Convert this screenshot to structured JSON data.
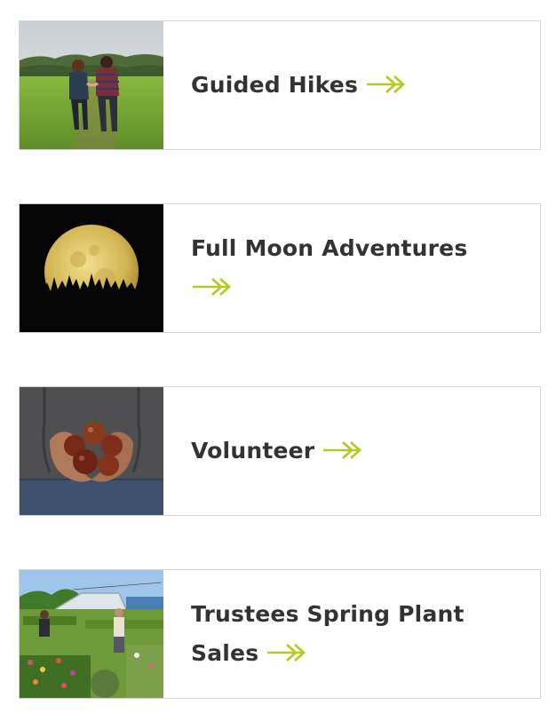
{
  "accent_color": "#b6c81e",
  "title_color": "#333333",
  "cards": [
    {
      "title": "Guided Hikes",
      "image": "couple-walking-field-photo",
      "arrow_icon": "double-chevron-arrow-icon"
    },
    {
      "title": "Full Moon Adventures",
      "image": "full-moon-over-trees-photo",
      "arrow_icon": "double-chevron-arrow-icon"
    },
    {
      "title": "Volunteer",
      "image": "hands-holding-tomatoes-photo",
      "arrow_icon": "double-chevron-arrow-icon"
    },
    {
      "title": "Trustees Spring Plant Sales",
      "image": "plant-sale-greenhouse-photo",
      "arrow_icon": "double-chevron-arrow-icon"
    }
  ]
}
